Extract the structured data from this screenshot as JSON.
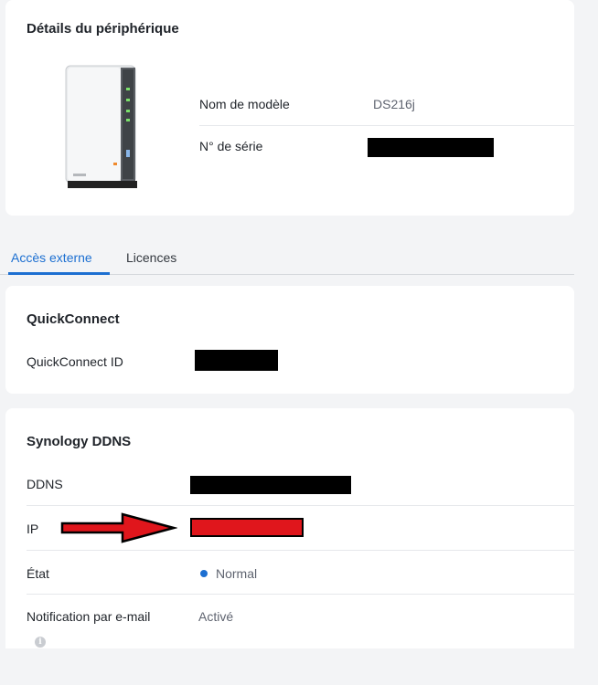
{
  "device": {
    "title": "Détails du périphérique",
    "model_label": "Nom de modèle",
    "model_value": "DS216j",
    "serial_label": "N° de série"
  },
  "tabs": [
    {
      "label": "Accès externe",
      "active": true
    },
    {
      "label": "Licences",
      "active": false
    }
  ],
  "quickconnect": {
    "title": "QuickConnect",
    "id_label": "QuickConnect ID"
  },
  "ddns": {
    "title": "Synology DDNS",
    "ddns_label": "DDNS",
    "ip_label": "IP",
    "state_label": "État",
    "state_value": "Normal",
    "notification_label": "Notification par e-mail",
    "notification_value": "Activé"
  },
  "colors": {
    "accent": "#1c6fd1",
    "status_normal": "#1c6fd1",
    "arrow": "#e0161c",
    "redaction": "#000000"
  },
  "icons": [
    "nas-device-icon",
    "info-icon",
    "red-arrow-annotation"
  ]
}
